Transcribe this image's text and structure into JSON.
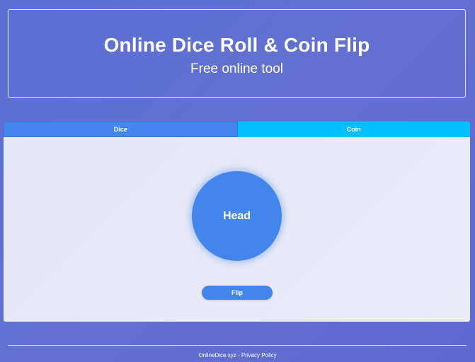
{
  "header": {
    "title": "Online Dice Roll & Coin Flip",
    "subtitle": "Free online tool"
  },
  "tabs": [
    {
      "label": "Dice",
      "active": false,
      "color": "#4286ee"
    },
    {
      "label": "Coin",
      "active": true,
      "color": "#04bfff"
    }
  ],
  "coin": {
    "result": "Head",
    "color": "#4286ec"
  },
  "flip_button": {
    "label": "Flip"
  },
  "footer": {
    "site_link": "OnlineDice.xyz",
    "separator": " - ",
    "privacy_link": "Privacy Policy"
  }
}
